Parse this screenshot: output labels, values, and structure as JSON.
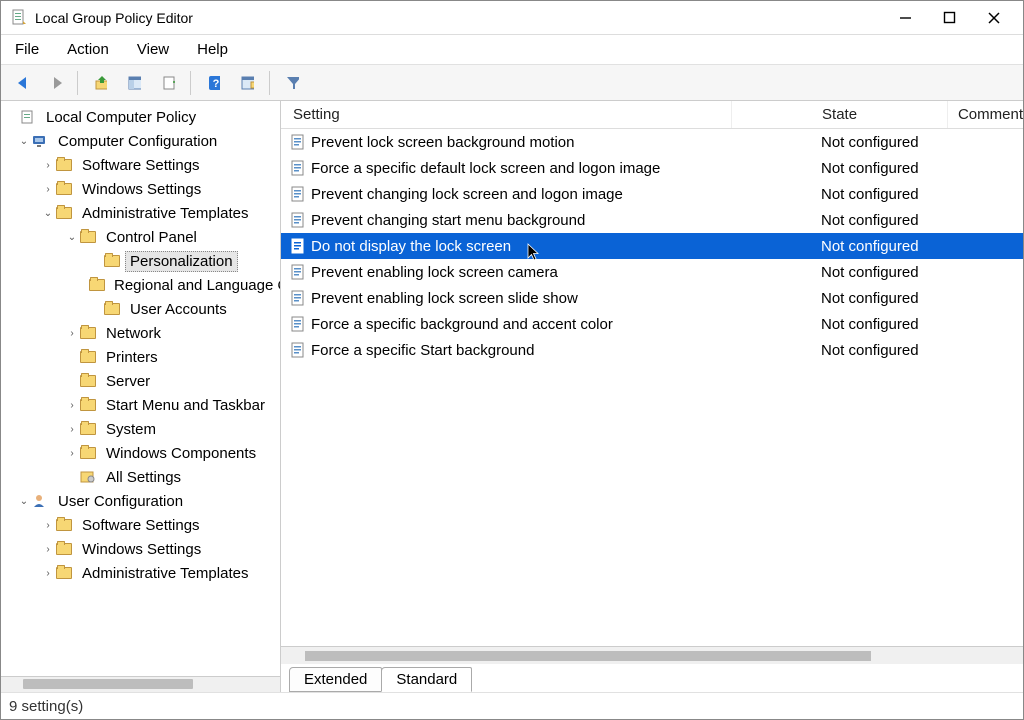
{
  "title": "Local Group Policy Editor",
  "menu": {
    "file": "File",
    "action": "Action",
    "view": "View",
    "help": "Help"
  },
  "tree": {
    "root": "Local Computer Policy",
    "cc": "Computer Configuration",
    "cc_ss": "Software Settings",
    "cc_ws": "Windows Settings",
    "cc_at": "Administrative Templates",
    "cc_at_cp": "Control Panel",
    "cc_at_cp_p": "Personalization",
    "cc_at_cp_rl": "Regional and Language Options",
    "cc_at_cp_ua": "User Accounts",
    "cc_at_net": "Network",
    "cc_at_pr": "Printers",
    "cc_at_srv": "Server",
    "cc_at_smt": "Start Menu and Taskbar",
    "cc_at_sys": "System",
    "cc_at_wc": "Windows Components",
    "cc_at_as": "All Settings",
    "uc": "User Configuration",
    "uc_ss": "Software Settings",
    "uc_ws": "Windows Settings",
    "uc_at": "Administrative Templates"
  },
  "columns": {
    "setting": "Setting",
    "state": "State",
    "comment": "Comment"
  },
  "rows": [
    {
      "name": "Prevent lock screen background motion",
      "state": "Not configured"
    },
    {
      "name": "Force a specific default lock screen and logon image",
      "state": "Not configured"
    },
    {
      "name": "Prevent changing lock screen and logon image",
      "state": "Not configured"
    },
    {
      "name": "Prevent changing start menu background",
      "state": "Not configured"
    },
    {
      "name": "Do not display the lock screen",
      "state": "Not configured",
      "selected": true
    },
    {
      "name": "Prevent enabling lock screen camera",
      "state": "Not configured"
    },
    {
      "name": "Prevent enabling lock screen slide show",
      "state": "Not configured"
    },
    {
      "name": "Force a specific background and accent color",
      "state": "Not configured"
    },
    {
      "name": "Force a specific Start background",
      "state": "Not configured"
    }
  ],
  "tabs": {
    "extended": "Extended",
    "standard": "Standard"
  },
  "status": "9 setting(s)"
}
